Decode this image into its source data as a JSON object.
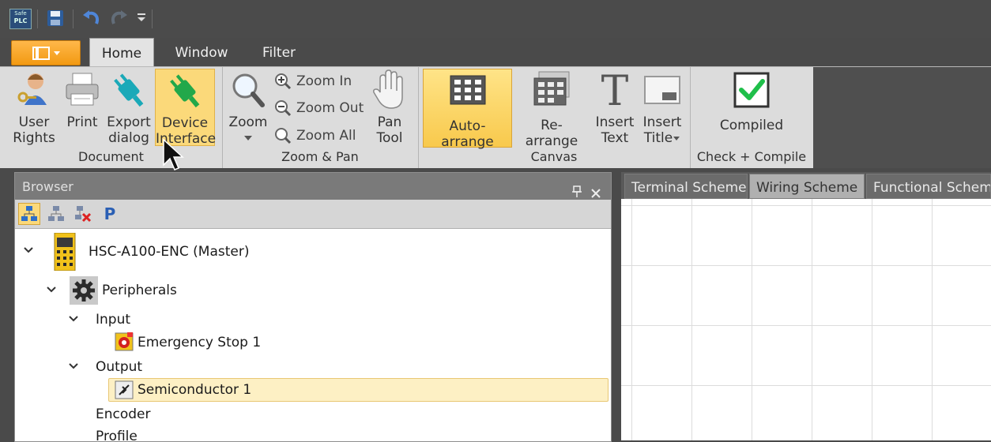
{
  "quick_access": {
    "logo_line1": "Safe",
    "logo_line2": "PLC",
    "icons": [
      "app-logo-icon",
      "save-icon",
      "undo-icon",
      "redo-icon",
      "customize-dropdown-icon"
    ]
  },
  "tabs": [
    {
      "label": "Home",
      "active": true
    },
    {
      "label": "Window",
      "active": false
    },
    {
      "label": "Filter",
      "active": false
    }
  ],
  "ribbon": {
    "document": {
      "label": "Document",
      "user_rights": [
        "User",
        "Rights"
      ],
      "print": "Print",
      "export_dialog": [
        "Export",
        "dialog"
      ],
      "device_interface": [
        "Device",
        "Interface"
      ]
    },
    "zoom_pan": {
      "label": "Zoom & Pan",
      "zoom": "Zoom",
      "zoom_in": "Zoom In",
      "zoom_out": "Zoom Out",
      "zoom_all": "Zoom All",
      "pan_tool": [
        "Pan",
        "Tool"
      ]
    },
    "canvas": {
      "label": "Canvas",
      "auto_arrange": "Auto-arrange",
      "re_arrange": "Re-arrange",
      "insert_text": [
        "Insert",
        "Text"
      ],
      "insert_title": [
        "Insert",
        "Title"
      ]
    },
    "check_compile": {
      "label": "Check + Compile",
      "compiled": "Compiled"
    }
  },
  "browser": {
    "title": "Browser",
    "toolbar_p": "P",
    "tree": {
      "master": "HSC-A100-ENC (Master)",
      "peripherals": "Peripherals",
      "input": "Input",
      "emergency_stop": "Emergency Stop 1",
      "output": "Output",
      "semiconductor": "Semiconductor 1",
      "encoder": "Encoder",
      "profile": "Profile"
    }
  },
  "scheme_tabs": [
    {
      "label": "Terminal Scheme",
      "active": false
    },
    {
      "label": "Wiring Scheme",
      "active": true
    },
    {
      "label": "Functional Scheme",
      "active": false
    }
  ],
  "colors": {
    "accent_orange": "#f29a12",
    "highlight_yellow": "#fbd97a",
    "connector_green": "#22a84a",
    "connector_teal": "#1aa9b8"
  }
}
